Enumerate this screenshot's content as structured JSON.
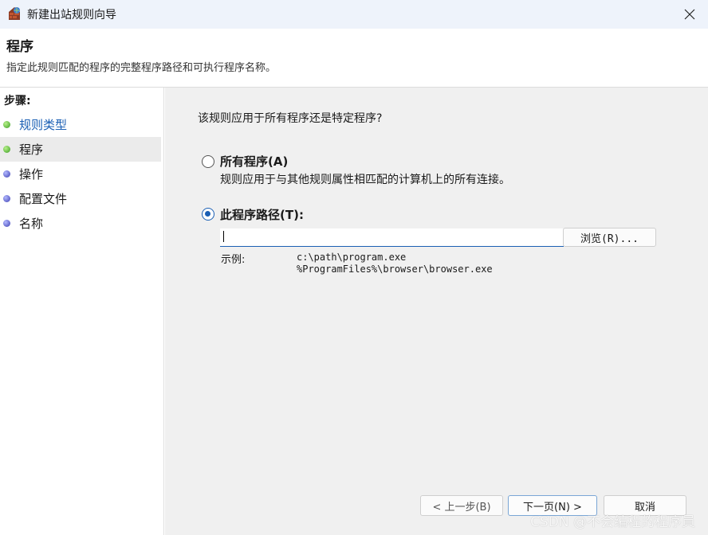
{
  "window": {
    "title": "新建出站规则向导"
  },
  "header": {
    "title": "程序",
    "description": "指定此规则匹配的程序的完整程序路径和可执行程序名称。"
  },
  "sidebar": {
    "label": "步骤:",
    "items": [
      {
        "label": "规则类型",
        "status": "done"
      },
      {
        "label": "程序",
        "status": "current"
      },
      {
        "label": "操作",
        "status": "pending"
      },
      {
        "label": "配置文件",
        "status": "pending"
      },
      {
        "label": "名称",
        "status": "pending"
      }
    ]
  },
  "main": {
    "question": "该规则应用于所有程序还是特定程序?",
    "options": [
      {
        "label": "所有程序(A)",
        "description": "规则应用于与其他规则属性相匹配的计算机上的所有连接。",
        "selected": false
      },
      {
        "label": "此程序路径(T):",
        "selected": true
      }
    ],
    "path": {
      "value": ""
    },
    "browse_label": "浏览(R)...",
    "example_label": "示例:",
    "example_lines": [
      "c:\\path\\program.exe",
      "%ProgramFiles%\\browser\\browser.exe"
    ]
  },
  "footer": {
    "back_label": "< 上一步(B)",
    "next_label": "下一页(N) >",
    "cancel_label": "取消"
  },
  "watermark": "CSDN @不会编程的程序員",
  "colors": {
    "accent": "#1a5fb4",
    "content_bg": "#f0f0f0",
    "titlebar_bg": "#eef3fb"
  },
  "icons": {
    "app": "firewall-icon",
    "close": "close-icon"
  }
}
